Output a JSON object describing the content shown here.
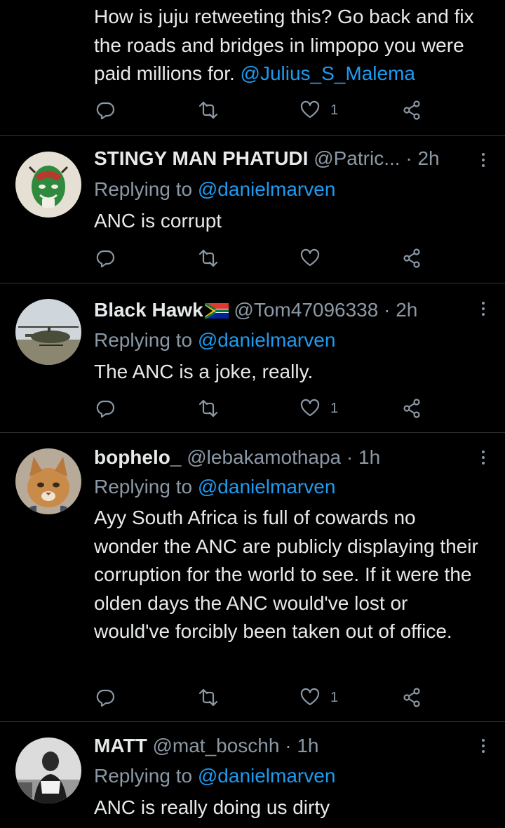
{
  "tweet0": {
    "text": "How is juju retweeting this? Go back and fix the roads and bridges in limpopo you were paid millions for.",
    "mention": "@Julius_S_Malema",
    "like_count": "1"
  },
  "tweet1": {
    "name": "STINGY MAN PHATUDI",
    "handle": "@Patric...",
    "dot": "·",
    "time": "2h",
    "replying_label": "Replying to",
    "replying_to": "@danielmarven",
    "text": "ANC is corrupt",
    "like_count": ""
  },
  "tweet2": {
    "name": "Black Hawk",
    "handle": "@Tom47096338",
    "dot": "·",
    "time": "2h",
    "replying_label": "Replying to",
    "replying_to": "@danielmarven",
    "text": "The ANC is a joke, really.",
    "like_count": "1"
  },
  "tweet3": {
    "name": "bophelo_",
    "handle": "@lebakamothapa",
    "dot": "·",
    "time": "1h",
    "replying_label": "Replying to",
    "replying_to": "@danielmarven",
    "text": "Ayy South Africa is full of cowards no wonder the ANC are publicly displaying their corruption for the world to see. If it were the olden days the ANC would've lost or would've forcibly been taken out of office.",
    "like_count": "1"
  },
  "tweet4": {
    "name": "MATT",
    "handle": "@mat_boschh",
    "dot": "·",
    "time": "1h",
    "replying_label": "Replying to",
    "replying_to": "@danielmarven",
    "text": "ANC is really doing us dirty"
  },
  "icons": {
    "reply": "reply-icon",
    "retweet": "retweet-icon",
    "like": "heart-icon",
    "share": "share-icon",
    "more": "more-options-icon"
  },
  "colors": {
    "background": "#000000",
    "text": "#e7e9ea",
    "secondary": "#8b98a5",
    "link": "#1d9bf0",
    "divider": "#2f3336"
  }
}
